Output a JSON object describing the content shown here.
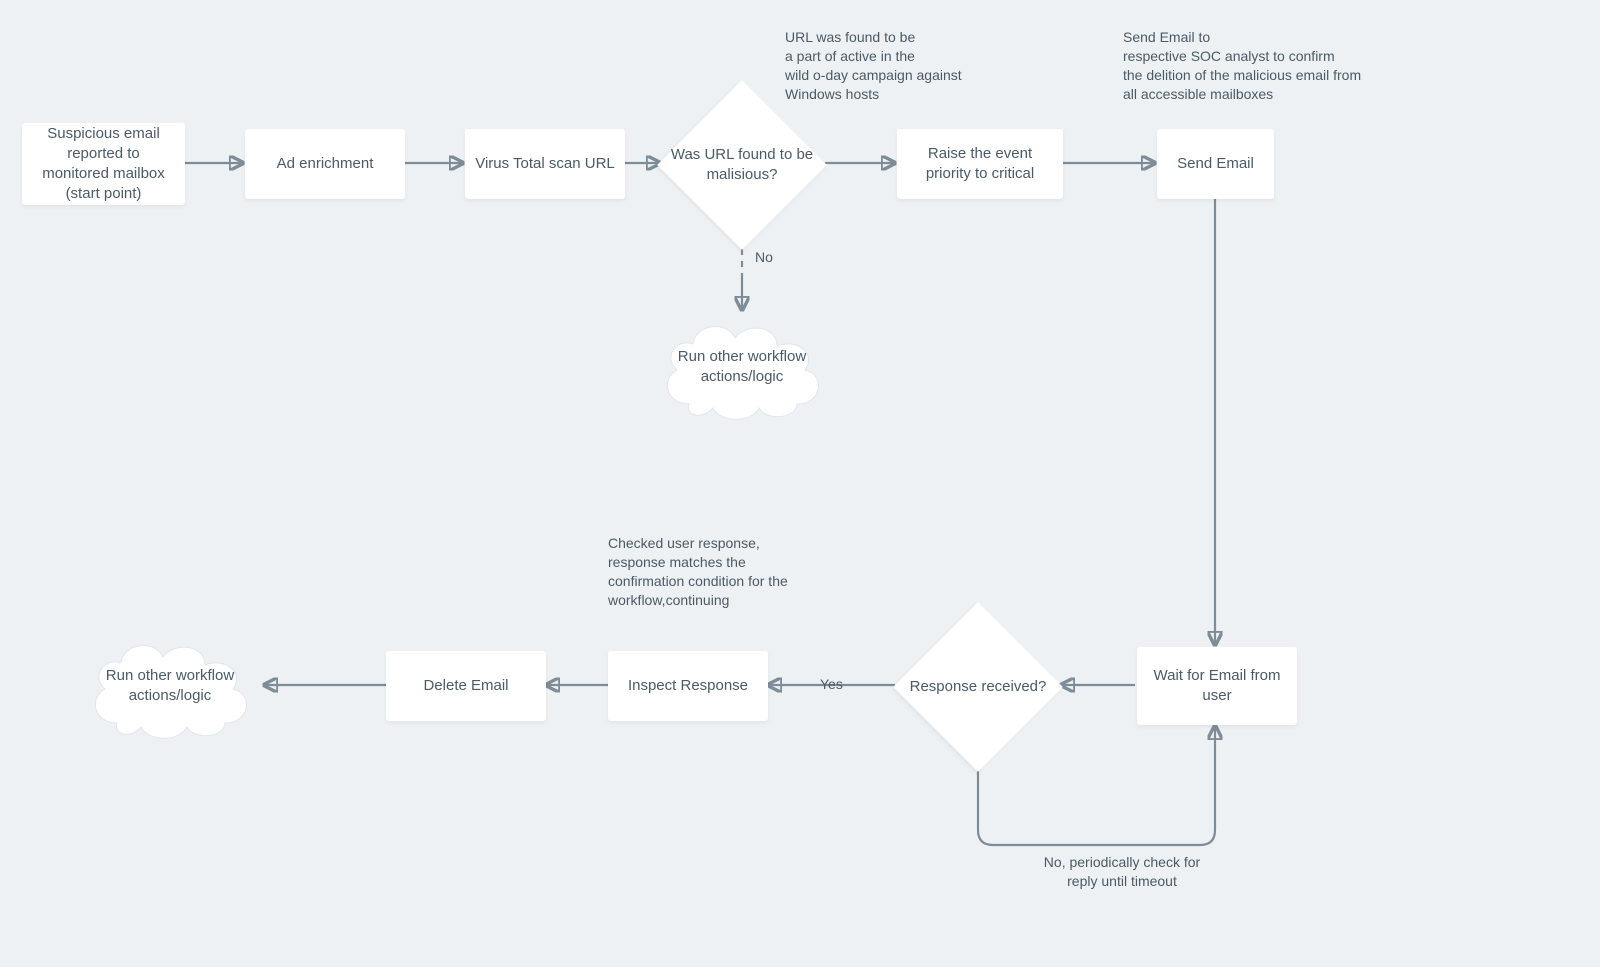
{
  "nodes": {
    "start": "Suspicious email reported to monitored mailbox (start point)",
    "enrich": "Ad enrichment",
    "vt": "Virus Total scan URL",
    "decision_url": "Was URL found to be malisious?",
    "raise": "Raise the event priority to critical",
    "send_email": "Send Email",
    "wait": "Wait for Email from user",
    "decision_resp": "Response received?",
    "inspect": "Inspect Response",
    "delete": "Delete Email",
    "cloud_top": "Run other workflow actions/logic",
    "cloud_bottom": "Run other workflow actions/logic"
  },
  "annotations": {
    "url_found": "URL was found to be\na part of active in the\nwild o-day campaign against\nWindows hosts",
    "send_note": "Send Email to\nrespective SOC analyst to confirm\nthe delition of the malicious email from\nall accessible mailboxes",
    "resp_note": "Checked user response,\nresponse matches the\nconfirmation condition for the\nworkflow,continuing"
  },
  "edge_labels": {
    "no_top": "No",
    "yes": "Yes",
    "no_loop": "No, periodically check for\nreply until timeout"
  },
  "colors": {
    "background": "#eef1f3",
    "node_bg": "#ffffff",
    "text": "#4a5a66",
    "arrow": "#7d8d97"
  }
}
